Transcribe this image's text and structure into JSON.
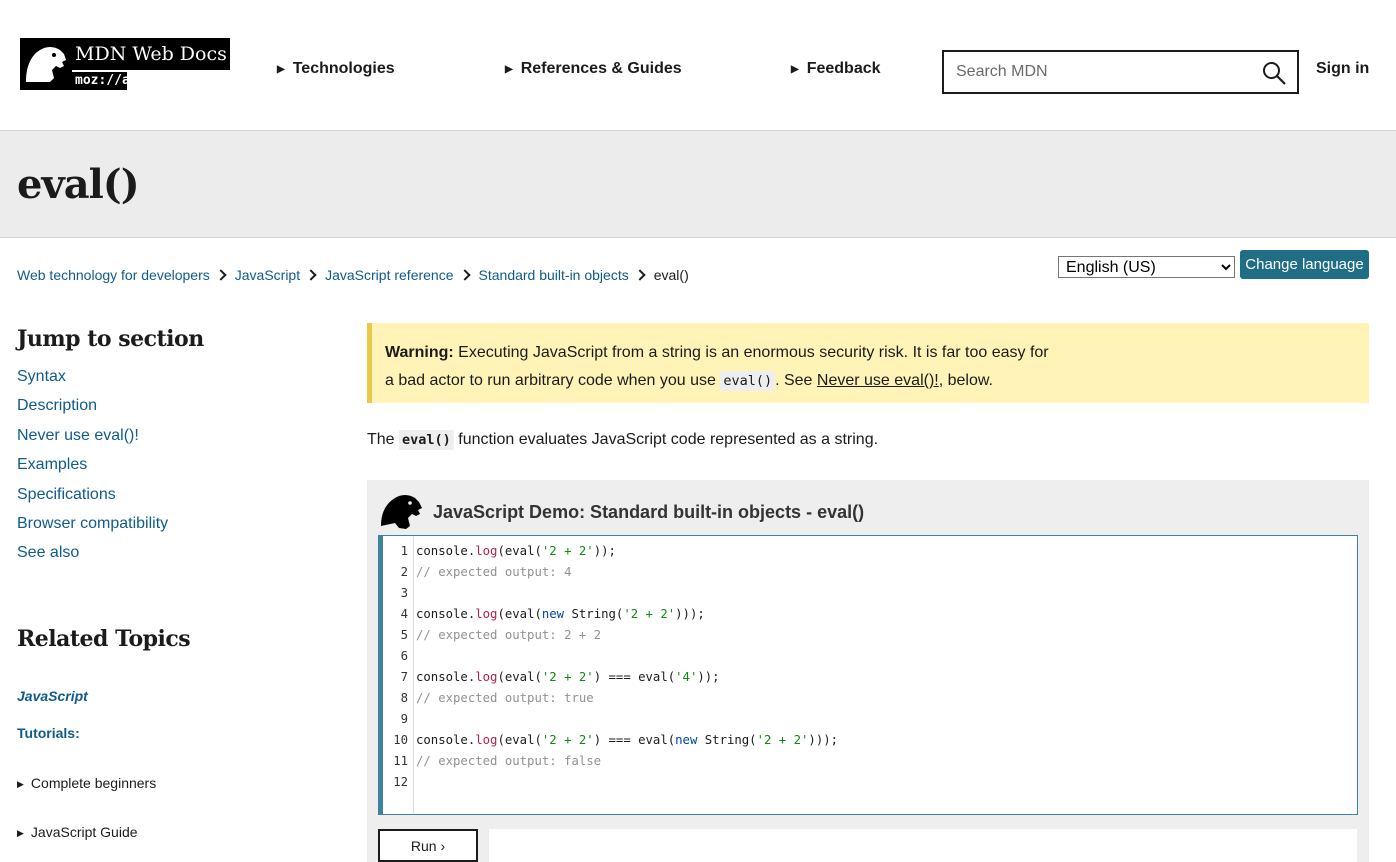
{
  "header": {
    "logo_text": "MDN Web Docs",
    "logo_sub": "moz://a",
    "nav": [
      "Technologies",
      "References & Guides",
      "Feedback"
    ],
    "search_placeholder": "Search MDN",
    "signin": "Sign in"
  },
  "page": {
    "title": "eval()"
  },
  "breadcrumbs": [
    "Web technology for developers",
    "JavaScript",
    "JavaScript reference",
    "Standard built-in objects",
    "eval()"
  ],
  "language": {
    "selected": "English (US)",
    "button": "Change language"
  },
  "sidebar": {
    "jump_title": "Jump to section",
    "toc": [
      "Syntax",
      "Description",
      "Never use eval()!",
      "Examples",
      "Specifications",
      "Browser compatibility",
      "See also"
    ],
    "related_title": "Related Topics",
    "related_link": "JavaScript",
    "tutorials_label": "Tutorials:",
    "tutorial_items": [
      "Complete beginners",
      "JavaScript Guide"
    ]
  },
  "warning": {
    "label": "Warning:",
    "text1": " Executing JavaScript from a string is an enormous security risk. It is far too easy for",
    "text2": "a bad actor to run arbitrary code when you use ",
    "code": "eval()",
    "text3": ". See ",
    "link": "Never use eval()!",
    "text4": ", below."
  },
  "intro": {
    "pre": "The ",
    "code": "eval()",
    "post": " function evaluates JavaScript code represented as a string."
  },
  "demo": {
    "title": "JavaScript Demo: Standard built-in objects - eval()",
    "line_numbers": [
      "1",
      "2",
      "3",
      "4",
      "5",
      "6",
      "7",
      "8",
      "9",
      "10",
      "11",
      "12"
    ],
    "run_label": "Run ›"
  }
}
